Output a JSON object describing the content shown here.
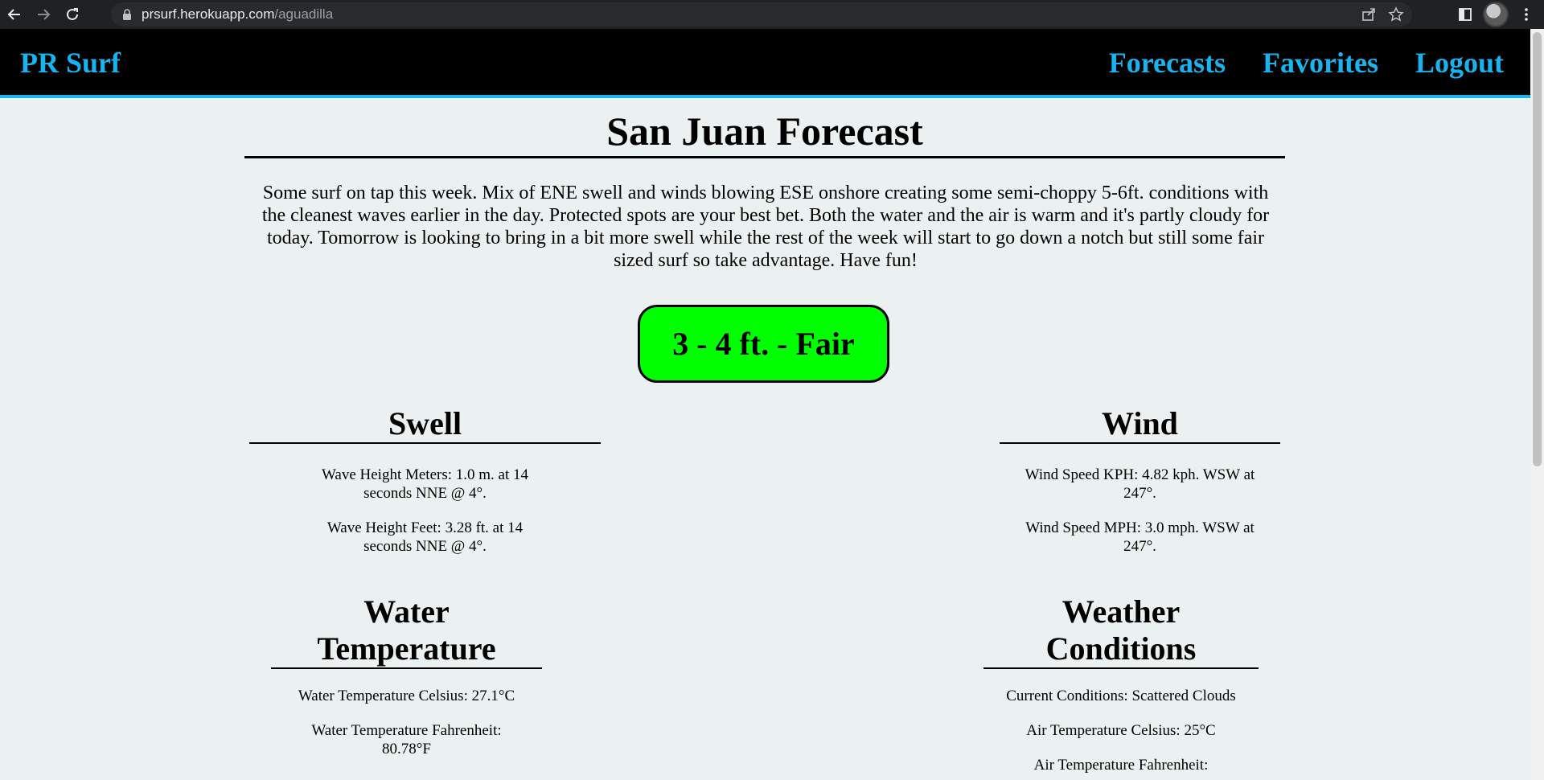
{
  "browser": {
    "url_host": "prsurf.herokuapp.com",
    "url_path": "/aguadilla"
  },
  "navbar": {
    "brand": "PR Surf",
    "links": [
      "Forecasts",
      "Favorites",
      "Logout"
    ]
  },
  "page": {
    "title": "San Juan Forecast",
    "summary": "Some surf on tap this week. Mix of ENE swell and winds blowing ESE onshore creating some semi-choppy 5-6ft. conditions with the cleanest waves earlier in the day. Protected spots are your best bet. Both the water and the air is warm and it's partly cloudy for today. Tomorrow is looking to bring in a bit more swell while the rest of the week will start to go down a notch but still some fair sized surf so take advantage. Have fun!",
    "rating": "3 - 4 ft. - Fair",
    "rating_color": "#00ff00"
  },
  "swell": {
    "heading": "Swell",
    "items": [
      "Wave Height Meters: 1.0 m. at 14 seconds NNE @ 4°.",
      "Wave Height Feet: 3.28 ft. at 14 seconds NNE @ 4°."
    ]
  },
  "wind": {
    "heading": "Wind",
    "items": [
      "Wind Speed KPH: 4.82 kph. WSW at 247°.",
      "Wind Speed MPH: 3.0 mph. WSW at 247°."
    ]
  },
  "water": {
    "heading": "Water Temperature",
    "items": [
      "Water Temperature Celsius: 27.1°C",
      "Water Temperature Fahrenheit: 80.78°F"
    ]
  },
  "weather": {
    "heading": "Weather Conditions",
    "items": [
      "Current Conditions: Scattered Clouds",
      "Air Temperature Celsius: 25°C",
      "Air Temperature Fahrenheit:"
    ]
  },
  "colors": {
    "accent": "#18b4ef",
    "navbar_bg": "#000000",
    "page_bg": "#ebf1f0"
  }
}
